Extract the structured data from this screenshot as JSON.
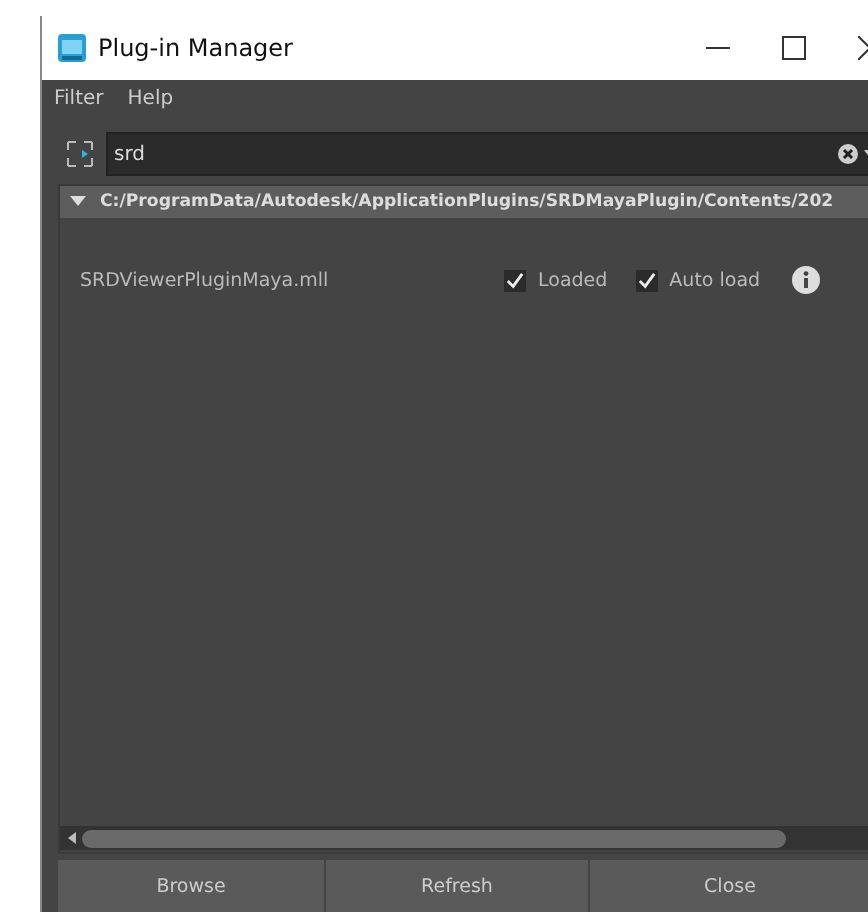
{
  "window": {
    "title": "Plug-in Manager"
  },
  "menu": [
    "Filter",
    "Help"
  ],
  "search": {
    "value": "srd"
  },
  "group": {
    "path": "C:/ProgramData/Autodesk/ApplicationPlugins/SRDMayaPlugin/Contents/202",
    "expanded": true
  },
  "plugins": [
    {
      "name": "SRDViewerPluginMaya.mll",
      "loaded_label": "Loaded",
      "loaded": true,
      "autoload_label": "Auto load",
      "autoload": true
    }
  ],
  "buttons": [
    "Browse",
    "Refresh",
    "Close"
  ]
}
